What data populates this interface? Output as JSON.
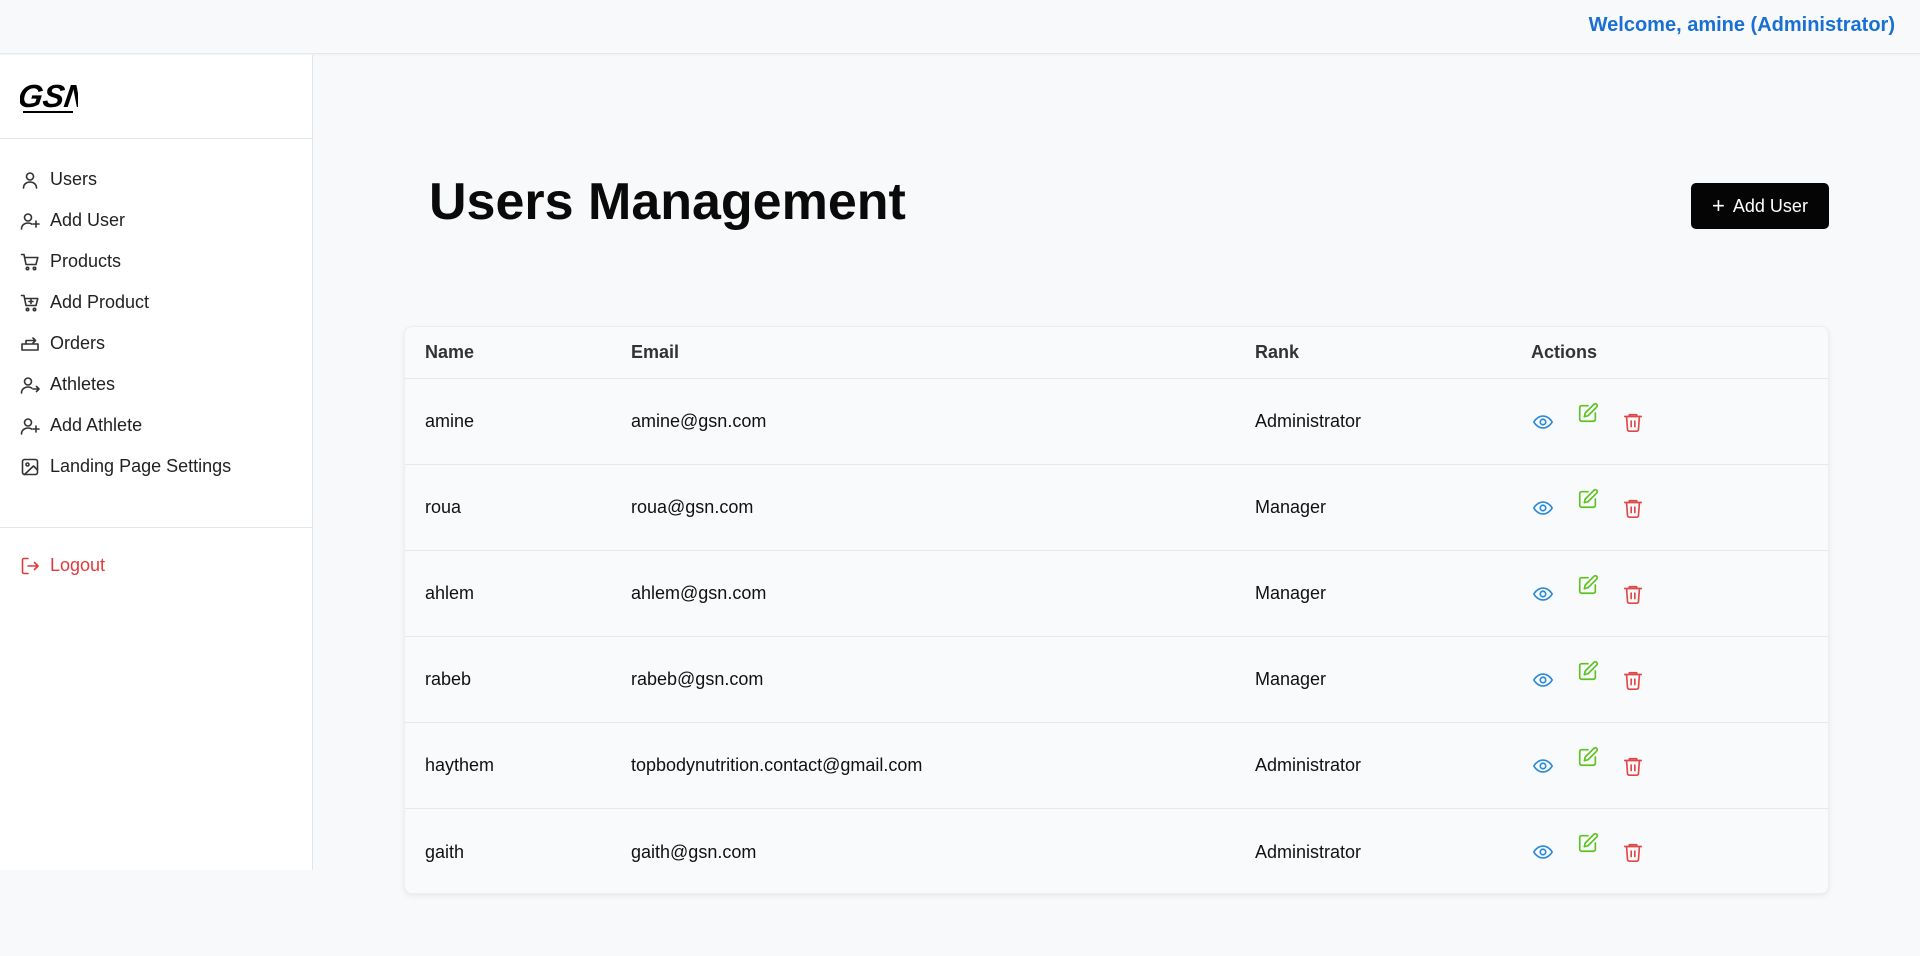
{
  "header": {
    "welcome": "Welcome, amine (Administrator)"
  },
  "sidebar": {
    "logo": "GSN",
    "items": [
      {
        "label": "Users",
        "icon": "user-icon"
      },
      {
        "label": "Add User",
        "icon": "user-plus-icon"
      },
      {
        "label": "Products",
        "icon": "cart-icon"
      },
      {
        "label": "Add Product",
        "icon": "cart-plus-icon"
      },
      {
        "label": "Orders",
        "icon": "orders-icon"
      },
      {
        "label": "Athletes",
        "icon": "user-arrow-icon"
      },
      {
        "label": "Add Athlete",
        "icon": "user-plus-icon"
      },
      {
        "label": "Landing Page Settings",
        "icon": "image-icon"
      }
    ],
    "logout": "Logout"
  },
  "main": {
    "title": "Users Management",
    "add_button": "Add User",
    "table": {
      "columns": [
        "Name",
        "Email",
        "Rank",
        "Actions"
      ],
      "rows": [
        {
          "name": "amine",
          "email": "amine@gsn.com",
          "rank": "Administrator"
        },
        {
          "name": "roua",
          "email": "roua@gsn.com",
          "rank": "Manager"
        },
        {
          "name": "ahlem",
          "email": "ahlem@gsn.com",
          "rank": "Manager"
        },
        {
          "name": "rabeb",
          "email": "rabeb@gsn.com",
          "rank": "Manager"
        },
        {
          "name": "haythem",
          "email": "topbodynutrition.contact@gmail.com",
          "rank": "Administrator"
        },
        {
          "name": "gaith",
          "email": "gaith@gsn.com",
          "rank": "Administrator"
        }
      ]
    }
  },
  "colors": {
    "accent_text": "#1a6fd3",
    "logout": "#e03b3b",
    "view_icon": "#2b8ad8",
    "edit_icon": "#5cc21f",
    "delete_icon": "#e04848",
    "button_bg": "#050505"
  }
}
